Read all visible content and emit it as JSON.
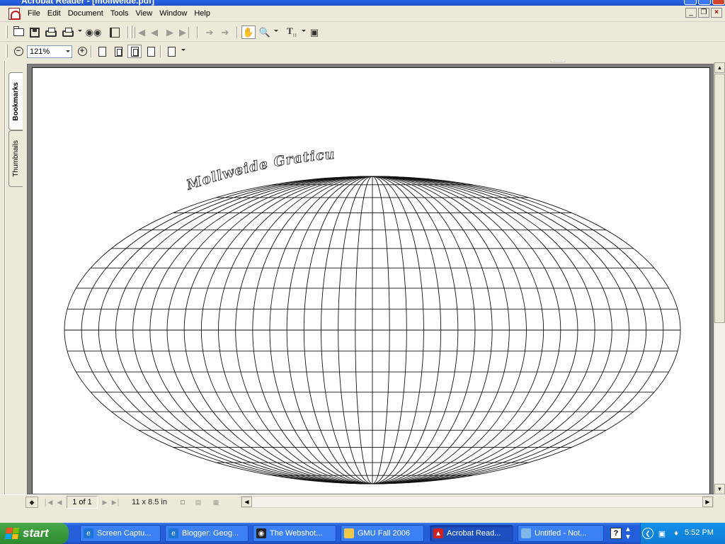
{
  "window": {
    "title": "Acrobat Reader - [mollweide.pdf]"
  },
  "menu": {
    "items": [
      "File",
      "Edit",
      "Document",
      "Tools",
      "View",
      "Window",
      "Help"
    ]
  },
  "toolbar": {
    "zoom_value": "121%",
    "brand": "Adobe"
  },
  "nav_tabs": {
    "bookmarks": "Bookmarks",
    "thumbnails": "Thumbnails"
  },
  "document": {
    "map_title": "Mollweide Graticule",
    "meridian_count": 36,
    "parallel_step_deg": 10
  },
  "status": {
    "page_indicator": "1 of 1",
    "page_size": "11 x 8.5 in"
  },
  "taskbar": {
    "start_label": "start",
    "tasks": [
      {
        "label": "Screen Captu...",
        "icon": "ie-icon",
        "color": "#1e73d8"
      },
      {
        "label": "Blogger: Geog...",
        "icon": "ie-icon",
        "color": "#1e73d8"
      },
      {
        "label": "The Webshot...",
        "icon": "camera-icon",
        "color": "#222222"
      },
      {
        "label": "GMU Fall 2006",
        "icon": "folder-icon",
        "color": "#f0c94a"
      },
      {
        "label": "Acrobat Read...",
        "icon": "acrobat-icon",
        "color": "#d21f1f",
        "active": true
      },
      {
        "label": "Untitled - Not...",
        "icon": "notepad-icon",
        "color": "#7fb7e8"
      }
    ],
    "clock": "5:52 PM"
  },
  "colors": {
    "taskbar_blue": "#245edb",
    "start_green": "#3a9a3a",
    "tray_blue": "#0f7cd6",
    "acrobat_red": "#d21f1f"
  }
}
